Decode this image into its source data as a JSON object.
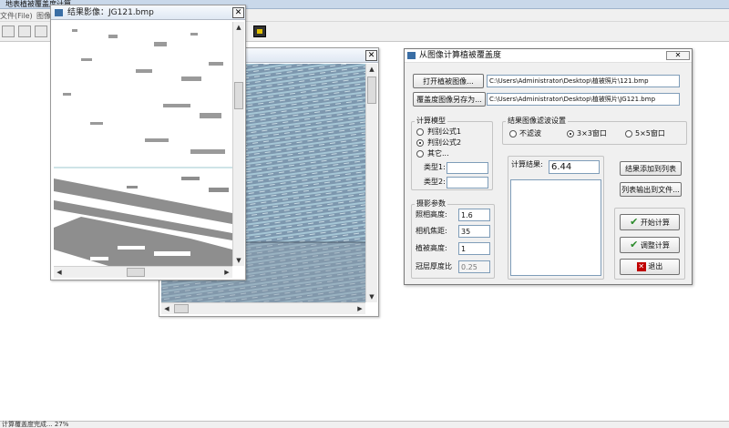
{
  "app": {
    "title": "地表植被覆盖度计算",
    "menu": {
      "file": "文件(File)",
      "image": "图像"
    }
  },
  "result_window": {
    "title": "结果影像：JG121.bmp",
    "close": "✕"
  },
  "source_window": {
    "close": "✕"
  },
  "dialog": {
    "title": "从图像计算植被覆盖度",
    "close": "✕",
    "open_button": "打开植被图像...",
    "open_path": "C:\\Users\\Administrator\\Desktop\\植被照片\\121.bmp",
    "saveas_button": "覆盖度图像另存为...",
    "saveas_path": "C:\\Users\\Administrator\\Desktop\\植被照片\\JG121.bmp",
    "model_group": "计算模型",
    "model_options": [
      "判别公式1",
      "判别公式2",
      "其它..."
    ],
    "model_selected": "判别公式2",
    "type1_label": "类型1:",
    "type2_label": "类型2:",
    "filter_group": "结果图像滤波设置",
    "filter_options": [
      "不滤波",
      "3×3窗口",
      "5×5窗口"
    ],
    "filter_selected": "3×3窗口",
    "photo_group": "摄影参数",
    "camera_height_label": "照相高度:",
    "camera_height": "1.6",
    "focal_length_label": "相机焦距:",
    "focal_length": "35",
    "veg_height_label": "植被高度:",
    "veg_height": "1",
    "canopy_ratio_label": "冠层厚度比",
    "canopy_ratio": "0.25",
    "result_label": "计算结果:",
    "result_value": "6.44",
    "add_to_list_button": "结果添加到列表",
    "export_list_button": "列表输出到文件...",
    "start_button": "开始计算",
    "adjust_button": "调整计算",
    "exit_button": "退出"
  },
  "statusbar": {
    "text": "计算覆盖度完成... 27%"
  },
  "colors": {
    "accent": "#2a8a2a",
    "exit": "#c00000",
    "titlebar": "#c9d8ea"
  }
}
